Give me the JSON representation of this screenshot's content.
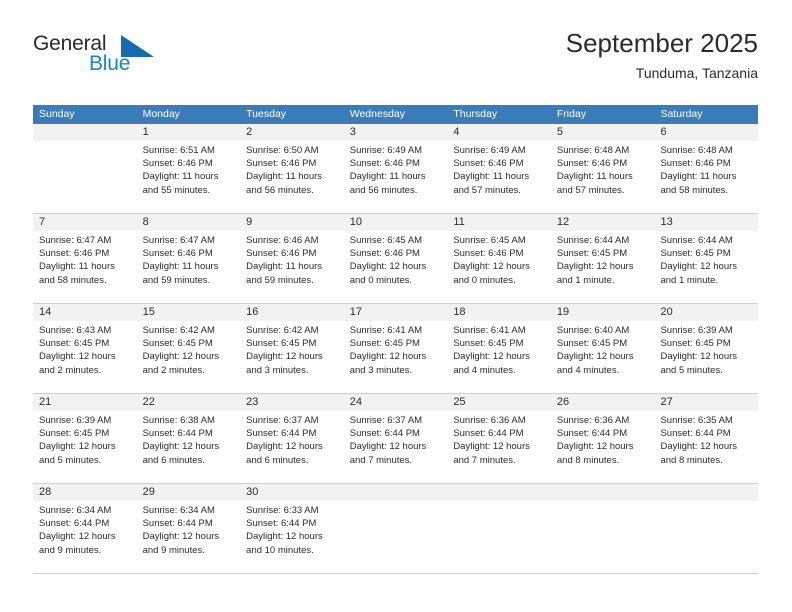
{
  "brand": {
    "name_part1": "General",
    "name_part2": "Blue",
    "accent_color": "#1b7fd4",
    "triangle_color": "#1769b0"
  },
  "header": {
    "title": "September 2025",
    "subtitle": "Tunduma, Tanzania"
  },
  "calendar": {
    "header_bg": "#3b7cb8",
    "daynum_bg": "#f2f2f2",
    "weekdays": [
      "Sunday",
      "Monday",
      "Tuesday",
      "Wednesday",
      "Thursday",
      "Friday",
      "Saturday"
    ],
    "weeks": [
      [
        {
          "day": "",
          "sunrise": "",
          "sunset": "",
          "daylight1": "",
          "daylight2": ""
        },
        {
          "day": "1",
          "sunrise": "Sunrise: 6:51 AM",
          "sunset": "Sunset: 6:46 PM",
          "daylight1": "Daylight: 11 hours",
          "daylight2": "and 55 minutes."
        },
        {
          "day": "2",
          "sunrise": "Sunrise: 6:50 AM",
          "sunset": "Sunset: 6:46 PM",
          "daylight1": "Daylight: 11 hours",
          "daylight2": "and 56 minutes."
        },
        {
          "day": "3",
          "sunrise": "Sunrise: 6:49 AM",
          "sunset": "Sunset: 6:46 PM",
          "daylight1": "Daylight: 11 hours",
          "daylight2": "and 56 minutes."
        },
        {
          "day": "4",
          "sunrise": "Sunrise: 6:49 AM",
          "sunset": "Sunset: 6:46 PM",
          "daylight1": "Daylight: 11 hours",
          "daylight2": "and 57 minutes."
        },
        {
          "day": "5",
          "sunrise": "Sunrise: 6:48 AM",
          "sunset": "Sunset: 6:46 PM",
          "daylight1": "Daylight: 11 hours",
          "daylight2": "and 57 minutes."
        },
        {
          "day": "6",
          "sunrise": "Sunrise: 6:48 AM",
          "sunset": "Sunset: 6:46 PM",
          "daylight1": "Daylight: 11 hours",
          "daylight2": "and 58 minutes."
        }
      ],
      [
        {
          "day": "7",
          "sunrise": "Sunrise: 6:47 AM",
          "sunset": "Sunset: 6:46 PM",
          "daylight1": "Daylight: 11 hours",
          "daylight2": "and 58 minutes."
        },
        {
          "day": "8",
          "sunrise": "Sunrise: 6:47 AM",
          "sunset": "Sunset: 6:46 PM",
          "daylight1": "Daylight: 11 hours",
          "daylight2": "and 59 minutes."
        },
        {
          "day": "9",
          "sunrise": "Sunrise: 6:46 AM",
          "sunset": "Sunset: 6:46 PM",
          "daylight1": "Daylight: 11 hours",
          "daylight2": "and 59 minutes."
        },
        {
          "day": "10",
          "sunrise": "Sunrise: 6:45 AM",
          "sunset": "Sunset: 6:46 PM",
          "daylight1": "Daylight: 12 hours",
          "daylight2": "and 0 minutes."
        },
        {
          "day": "11",
          "sunrise": "Sunrise: 6:45 AM",
          "sunset": "Sunset: 6:46 PM",
          "daylight1": "Daylight: 12 hours",
          "daylight2": "and 0 minutes."
        },
        {
          "day": "12",
          "sunrise": "Sunrise: 6:44 AM",
          "sunset": "Sunset: 6:45 PM",
          "daylight1": "Daylight: 12 hours",
          "daylight2": "and 1 minute."
        },
        {
          "day": "13",
          "sunrise": "Sunrise: 6:44 AM",
          "sunset": "Sunset: 6:45 PM",
          "daylight1": "Daylight: 12 hours",
          "daylight2": "and 1 minute."
        }
      ],
      [
        {
          "day": "14",
          "sunrise": "Sunrise: 6:43 AM",
          "sunset": "Sunset: 6:45 PM",
          "daylight1": "Daylight: 12 hours",
          "daylight2": "and 2 minutes."
        },
        {
          "day": "15",
          "sunrise": "Sunrise: 6:42 AM",
          "sunset": "Sunset: 6:45 PM",
          "daylight1": "Daylight: 12 hours",
          "daylight2": "and 2 minutes."
        },
        {
          "day": "16",
          "sunrise": "Sunrise: 6:42 AM",
          "sunset": "Sunset: 6:45 PM",
          "daylight1": "Daylight: 12 hours",
          "daylight2": "and 3 minutes."
        },
        {
          "day": "17",
          "sunrise": "Sunrise: 6:41 AM",
          "sunset": "Sunset: 6:45 PM",
          "daylight1": "Daylight: 12 hours",
          "daylight2": "and 3 minutes."
        },
        {
          "day": "18",
          "sunrise": "Sunrise: 6:41 AM",
          "sunset": "Sunset: 6:45 PM",
          "daylight1": "Daylight: 12 hours",
          "daylight2": "and 4 minutes."
        },
        {
          "day": "19",
          "sunrise": "Sunrise: 6:40 AM",
          "sunset": "Sunset: 6:45 PM",
          "daylight1": "Daylight: 12 hours",
          "daylight2": "and 4 minutes."
        },
        {
          "day": "20",
          "sunrise": "Sunrise: 6:39 AM",
          "sunset": "Sunset: 6:45 PM",
          "daylight1": "Daylight: 12 hours",
          "daylight2": "and 5 minutes."
        }
      ],
      [
        {
          "day": "21",
          "sunrise": "Sunrise: 6:39 AM",
          "sunset": "Sunset: 6:45 PM",
          "daylight1": "Daylight: 12 hours",
          "daylight2": "and 5 minutes."
        },
        {
          "day": "22",
          "sunrise": "Sunrise: 6:38 AM",
          "sunset": "Sunset: 6:44 PM",
          "daylight1": "Daylight: 12 hours",
          "daylight2": "and 6 minutes."
        },
        {
          "day": "23",
          "sunrise": "Sunrise: 6:37 AM",
          "sunset": "Sunset: 6:44 PM",
          "daylight1": "Daylight: 12 hours",
          "daylight2": "and 6 minutes."
        },
        {
          "day": "24",
          "sunrise": "Sunrise: 6:37 AM",
          "sunset": "Sunset: 6:44 PM",
          "daylight1": "Daylight: 12 hours",
          "daylight2": "and 7 minutes."
        },
        {
          "day": "25",
          "sunrise": "Sunrise: 6:36 AM",
          "sunset": "Sunset: 6:44 PM",
          "daylight1": "Daylight: 12 hours",
          "daylight2": "and 7 minutes."
        },
        {
          "day": "26",
          "sunrise": "Sunrise: 6:36 AM",
          "sunset": "Sunset: 6:44 PM",
          "daylight1": "Daylight: 12 hours",
          "daylight2": "and 8 minutes."
        },
        {
          "day": "27",
          "sunrise": "Sunrise: 6:35 AM",
          "sunset": "Sunset: 6:44 PM",
          "daylight1": "Daylight: 12 hours",
          "daylight2": "and 8 minutes."
        }
      ],
      [
        {
          "day": "28",
          "sunrise": "Sunrise: 6:34 AM",
          "sunset": "Sunset: 6:44 PM",
          "daylight1": "Daylight: 12 hours",
          "daylight2": "and 9 minutes."
        },
        {
          "day": "29",
          "sunrise": "Sunrise: 6:34 AM",
          "sunset": "Sunset: 6:44 PM",
          "daylight1": "Daylight: 12 hours",
          "daylight2": "and 9 minutes."
        },
        {
          "day": "30",
          "sunrise": "Sunrise: 6:33 AM",
          "sunset": "Sunset: 6:44 PM",
          "daylight1": "Daylight: 12 hours",
          "daylight2": "and 10 minutes."
        },
        {
          "day": "",
          "sunrise": "",
          "sunset": "",
          "daylight1": "",
          "daylight2": ""
        },
        {
          "day": "",
          "sunrise": "",
          "sunset": "",
          "daylight1": "",
          "daylight2": ""
        },
        {
          "day": "",
          "sunrise": "",
          "sunset": "",
          "daylight1": "",
          "daylight2": ""
        },
        {
          "day": "",
          "sunrise": "",
          "sunset": "",
          "daylight1": "",
          "daylight2": ""
        }
      ]
    ]
  }
}
